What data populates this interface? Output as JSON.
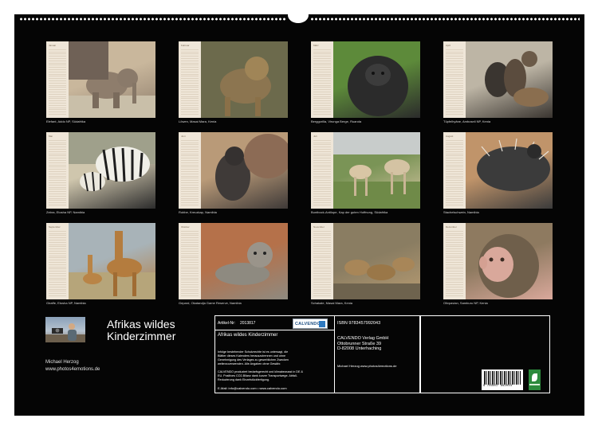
{
  "months": [
    {
      "name": "Januar",
      "caption": "Elefant, Addo NP, Südafrika",
      "icon": "elephant-calf-photo",
      "colors": [
        "#c9b79c",
        "#8e7d6c"
      ]
    },
    {
      "name": "Februar",
      "caption": "Löwen, Masai Mara, Kenia",
      "icon": "lion-cub-photo",
      "colors": [
        "#a99a7a",
        "#8c7550"
      ]
    },
    {
      "name": "März",
      "caption": "Berggorilla, Virunga Berge, Ruanda",
      "icon": "gorilla-photo",
      "colors": [
        "#5d8a3a",
        "#2b2b2b"
      ]
    },
    {
      "name": "April",
      "caption": "Tüpfelhyäne, Amboseli NP, Kenia",
      "icon": "hyena-cubs-photo",
      "colors": [
        "#bdb5a5",
        "#3a3530"
      ]
    },
    {
      "name": "Mai",
      "caption": "Zebra, Etosha NP, Namibia",
      "icon": "zebra-photo",
      "colors": [
        "#cfc6ad",
        "#2c2c2c"
      ]
    },
    {
      "name": "Juni",
      "caption": "Robbe, Kreuzkap, Namibia",
      "icon": "seal-pup-photo",
      "colors": [
        "#b99a78",
        "#3f3a38"
      ]
    },
    {
      "name": "Juli",
      "caption": "Buntbock-Antilope, Kap der guten Hoffnung, Südafrika",
      "icon": "antelope-photo",
      "colors": [
        "#7a9456",
        "#d9c6a5"
      ]
    },
    {
      "name": "August",
      "caption": "Stachelschwein, Namibia",
      "icon": "porcupine-photo",
      "colors": [
        "#c0946a",
        "#3b3b3b"
      ]
    },
    {
      "name": "September",
      "caption": "Giraffe, Etosha NP, Namibia",
      "icon": "giraffe-photo",
      "colors": [
        "#a8b3b8",
        "#b47c3e"
      ]
    },
    {
      "name": "Oktober",
      "caption": "Gepard, Okatandja Game Reserve, Namibia",
      "icon": "cheetah-cub-photo",
      "colors": [
        "#b5714a",
        "#8e8a80"
      ]
    },
    {
      "name": "November",
      "caption": "Schakale, Masai Mara, Kenia",
      "icon": "jackals-photo",
      "colors": [
        "#8a7d62",
        "#b89c72"
      ]
    },
    {
      "name": "Dezember",
      "caption": "Olivpavian, Samburu NP, Kenia",
      "icon": "baboon-photo",
      "colors": [
        "#8e7a60",
        "#d9a89b"
      ]
    }
  ],
  "cover": {
    "title_line1": "Afrikas wildes",
    "title_line2": "Kinderzimmer",
    "author": "Michael Herzog",
    "website": "www.photos4emotions.de"
  },
  "info": {
    "article_label": "Artikel-Nr:",
    "article_no": "2013817",
    "brand": "CALVENDO",
    "product_title": "Afrikas wildes Kinderzimmer",
    "legal": [
      "Infolge bestehender Schutzrechte ist es untersagt, die",
      "Blätter dieses Kalenders herauszutrennen und ohne",
      "Genehmigung des Verlages zu gewerblichen Zwecken",
      "weiterzuverwenden. Alle Angaben ohne Gewähr.",
      "",
      "CALVENDO produziert bedarfsgerecht und klimabewusst in DE &",
      "EU. Positives CO2-Bilanz dank kurzer Transportwege. Abfall-",
      "Reduzierung dank Einzelstückfertigung."
    ],
    "email": "E-Mail: info@calvendo.com • www.calvendo.com",
    "isbn": "ISBN 9783457992043",
    "publisher_lines": [
      "CALVENDO Verlag GmbH",
      "Ottobrunner Straße 39",
      "D-82008 Unterhaching"
    ],
    "credit": "Michael Herzog www.photos4emotions.de",
    "barcode_number": "9 783457 992043"
  }
}
